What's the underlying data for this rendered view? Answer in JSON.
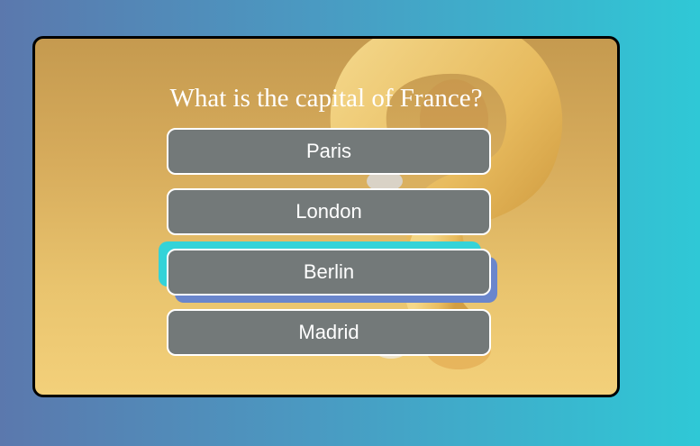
{
  "quiz": {
    "question": "What is the capital of France?",
    "answers": [
      {
        "label": "Paris"
      },
      {
        "label": "London"
      },
      {
        "label": "Berlin",
        "state": "hover"
      },
      {
        "label": "Madrid"
      }
    ]
  },
  "colors": {
    "page_gradient_start": "#5b78ad",
    "page_gradient_end": "#2fc8d6",
    "card_background": "#d7ac5c",
    "answer_button": "#737979",
    "hover_accent_cyan": "#34d3d8",
    "hover_accent_blue": "#6a86cc"
  },
  "icons": {
    "background_decoration": "question-mark-illustration"
  }
}
